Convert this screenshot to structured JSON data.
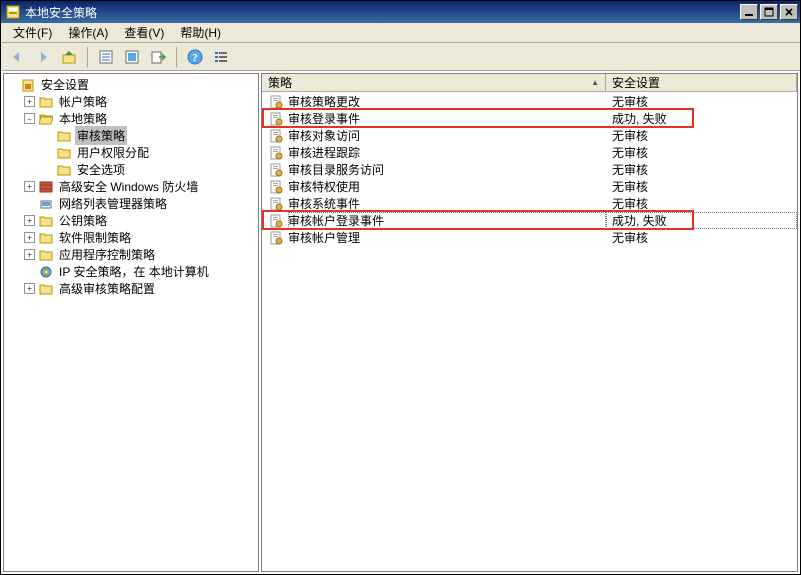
{
  "title": "本地安全策略",
  "menus": {
    "file": "文件(F)",
    "action": "操作(A)",
    "view": "查看(V)",
    "help": "帮助(H)"
  },
  "toolbar": {
    "back": "后退",
    "forward": "前进",
    "up": "上移",
    "props": "属性",
    "refresh": "刷新",
    "export": "导出",
    "help": "帮助",
    "list": "列表"
  },
  "winbtns": {
    "min": "最小化",
    "max": "最大化",
    "close": "关闭"
  },
  "tree": {
    "root": "安全设置",
    "account_policies": "帐户策略",
    "local_policies": "本地策略",
    "audit_policy": "审核策略",
    "user_rights": "用户权限分配",
    "security_options": "安全选项",
    "wfas": "高级安全 Windows 防火墙",
    "nlm": "网络列表管理器策略",
    "pk": "公钥策略",
    "srp": "软件限制策略",
    "acp": "应用程序控制策略",
    "ipsec": "IP 安全策略，在 本地计算机",
    "aapc": "高级审核策略配置"
  },
  "list": {
    "header_policy": "策略",
    "header_setting": "安全设置",
    "sort_arrow": "▲",
    "items": [
      {
        "name": "审核策略更改",
        "setting": "无审核"
      },
      {
        "name": "审核登录事件",
        "setting": "成功, 失败"
      },
      {
        "name": "审核对象访问",
        "setting": "无审核"
      },
      {
        "name": "审核进程跟踪",
        "setting": "无审核"
      },
      {
        "name": "审核目录服务访问",
        "setting": "无审核"
      },
      {
        "name": "审核特权使用",
        "setting": "无审核"
      },
      {
        "name": "审核系统事件",
        "setting": "无审核"
      },
      {
        "name": "审核帐户登录事件",
        "setting": "成功, 失败"
      },
      {
        "name": "审核帐户管理",
        "setting": "无审核"
      }
    ]
  }
}
